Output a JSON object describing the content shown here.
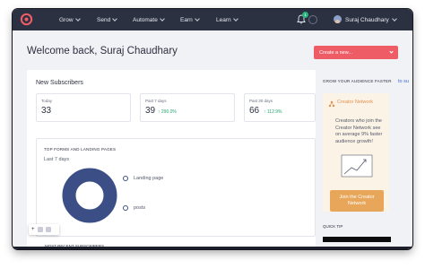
{
  "nav": {
    "items": [
      {
        "label": "Grow"
      },
      {
        "label": "Send"
      },
      {
        "label": "Automate"
      },
      {
        "label": "Earn"
      },
      {
        "label": "Learn"
      }
    ],
    "notification_count": "1",
    "user_name": "Suraj Chaudhary"
  },
  "header": {
    "welcome": "Welcome back, Suraj Chaudhary",
    "create_button": "Create a new..."
  },
  "subscribers": {
    "title": "New Subscribers",
    "stats": [
      {
        "label": "Today",
        "value": "33",
        "change": ""
      },
      {
        "label": "Past 7 days",
        "value": "39",
        "change": "↑ 290.0%"
      },
      {
        "label": "Past 30 days",
        "value": "66",
        "change": "↑ 112.9%"
      }
    ]
  },
  "forms": {
    "title": "TOP FORMS AND LANDING PAGES",
    "period": "Last 7 days",
    "legend": [
      {
        "label": "Landing page",
        "share": 1.0
      },
      {
        "label": "posts",
        "share": 0.0
      }
    ],
    "colors": {
      "primary": "#3b4f86"
    }
  },
  "recent_title": "MOST RECENT SUBSCRIBERS",
  "side": {
    "title": "GROW YOUR AUDIENCE FASTER",
    "cut_text": "to su",
    "creator": {
      "name": "Creator Network",
      "text": "Creators who join the Creator Network see on average 9% faster audience growth!",
      "button": "Join the Creator Network"
    },
    "quick_tip": "QUICK TIP"
  },
  "colors": {
    "nav_bg": "#2c3142",
    "accent": "#ee5c66",
    "creator_orange": "#e7a65a",
    "positive": "#26a36e"
  }
}
